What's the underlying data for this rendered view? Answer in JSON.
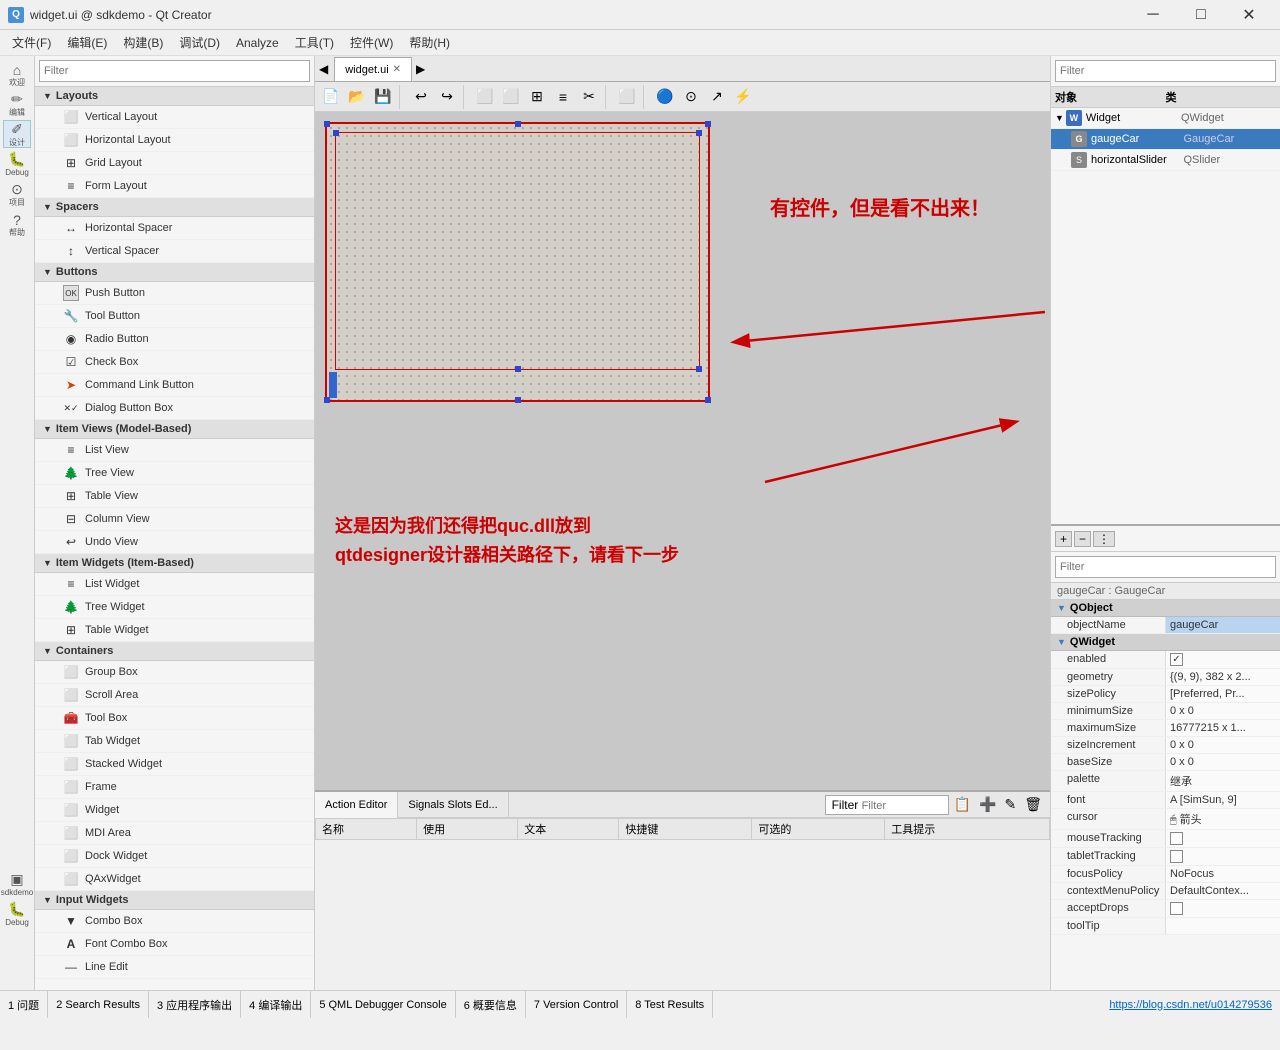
{
  "titleBar": {
    "appIcon": "Q",
    "title": "widget.ui @ sdkdemo - Qt Creator",
    "minimizeLabel": "─",
    "maximizeLabel": "□",
    "closeLabel": "✕"
  },
  "menuBar": {
    "items": [
      "文件(F)",
      "编辑(E)",
      "构建(B)",
      "调试(D)",
      "Analyze",
      "工具(T)",
      "控件(W)",
      "帮助(H)"
    ]
  },
  "tabs": [
    {
      "label": "widget.ui",
      "active": true
    }
  ],
  "widgetPanel": {
    "filterPlaceholder": "Filter",
    "categories": [
      {
        "name": "Layouts",
        "items": [
          {
            "label": "Vertical Layout",
            "icon": "⬜"
          },
          {
            "label": "Horizontal Layout",
            "icon": "⬜"
          },
          {
            "label": "Grid Layout",
            "icon": "⊞"
          },
          {
            "label": "Form Layout",
            "icon": "≡"
          }
        ]
      },
      {
        "name": "Spacers",
        "items": [
          {
            "label": "Horizontal Spacer",
            "icon": "↔"
          },
          {
            "label": "Vertical Spacer",
            "icon": "↕"
          }
        ]
      },
      {
        "name": "Buttons",
        "items": [
          {
            "label": "Push Button",
            "icon": "⬜"
          },
          {
            "label": "Tool Button",
            "icon": "🔧"
          },
          {
            "label": "Radio Button",
            "icon": "◉"
          },
          {
            "label": "Check Box",
            "icon": "☑"
          },
          {
            "label": "Command Link Button",
            "icon": "➤"
          },
          {
            "label": "Dialog Button Box",
            "icon": "⬜"
          }
        ]
      },
      {
        "name": "Item Views (Model-Based)",
        "items": [
          {
            "label": "List View",
            "icon": "≡"
          },
          {
            "label": "Tree View",
            "icon": "🌲"
          },
          {
            "label": "Table View",
            "icon": "⊞"
          },
          {
            "label": "Column View",
            "icon": "⊟"
          },
          {
            "label": "Undo View",
            "icon": "↩"
          }
        ]
      },
      {
        "name": "Item Widgets (Item-Based)",
        "items": [
          {
            "label": "List Widget",
            "icon": "≡"
          },
          {
            "label": "Tree Widget",
            "icon": "🌲"
          },
          {
            "label": "Table Widget",
            "icon": "⊞"
          }
        ]
      },
      {
        "name": "Containers",
        "items": [
          {
            "label": "Group Box",
            "icon": "⬜"
          },
          {
            "label": "Scroll Area",
            "icon": "⬜"
          },
          {
            "label": "Tool Box",
            "icon": "🧰"
          },
          {
            "label": "Tab Widget",
            "icon": "⬜"
          },
          {
            "label": "Stacked Widget",
            "icon": "⬜"
          },
          {
            "label": "Frame",
            "icon": "⬜"
          },
          {
            "label": "Widget",
            "icon": "⬜"
          },
          {
            "label": "MDI Area",
            "icon": "⬜"
          },
          {
            "label": "Dock Widget",
            "icon": "⬜"
          },
          {
            "label": "QAxWidget",
            "icon": "⬜"
          }
        ]
      },
      {
        "name": "Input Widgets",
        "items": [
          {
            "label": "Combo Box",
            "icon": "▼"
          },
          {
            "label": "Font Combo Box",
            "icon": "A"
          },
          {
            "label": "Line Edit",
            "icon": "—"
          }
        ]
      }
    ]
  },
  "objectInspector": {
    "filterPlaceholder": "Filter",
    "headers": {
      "col1": "对象",
      "col2": "类"
    },
    "objects": [
      {
        "level": 0,
        "name": "Widget",
        "class": "QWidget",
        "expanded": true,
        "icon": "W"
      },
      {
        "level": 1,
        "name": "gaugeCar",
        "class": "GaugeCar",
        "selected": true,
        "icon": "G"
      },
      {
        "level": 1,
        "name": "horizontalSlider",
        "class": "QSlider",
        "icon": "S"
      }
    ]
  },
  "propertyEditor": {
    "filterPlaceholder": "Filter",
    "subtitle": "gaugeCar : GaugeCar",
    "addBtn": "+",
    "removeBtn": "−",
    "moreBtn": "⋮",
    "groups": [
      {
        "name": "QObject",
        "expanded": true,
        "props": [
          {
            "name": "objectName",
            "value": "gaugeCar",
            "highlight": true
          }
        ]
      },
      {
        "name": "QWidget",
        "expanded": true,
        "props": [
          {
            "name": "enabled",
            "value": "checkbox_checked",
            "type": "checkbox"
          },
          {
            "name": "geometry",
            "value": "{(9, 9), 382 x 2..."
          },
          {
            "name": "sizePolicy",
            "value": "[Preferred, Pr..."
          },
          {
            "name": "minimumSize",
            "value": "0 x 0"
          },
          {
            "name": "maximumSize",
            "value": "16777215 x 1..."
          },
          {
            "name": "sizeIncrement",
            "value": "0 x 0"
          },
          {
            "name": "baseSize",
            "value": "0 x 0"
          },
          {
            "name": "palette",
            "value": "继承"
          },
          {
            "name": "font",
            "value": "A [SimSun, 9]"
          },
          {
            "name": "cursor",
            "value": "🖱 箭头"
          },
          {
            "name": "mouseTracking",
            "value": "checkbox_unchecked",
            "type": "checkbox"
          },
          {
            "name": "tabletTracking",
            "value": "checkbox_unchecked",
            "type": "checkbox"
          },
          {
            "name": "focusPolicy",
            "value": "NoFocus"
          },
          {
            "name": "contextMenuPolicy",
            "value": "DefaultContex..."
          },
          {
            "name": "acceptDrops",
            "value": "checkbox_unchecked",
            "type": "checkbox"
          },
          {
            "name": "toolTip",
            "value": ""
          }
        ]
      }
    ]
  },
  "actionEditor": {
    "tabLabels": [
      "Action Editor",
      "Signals Slots Ed..."
    ],
    "filterPlaceholder": "Filter",
    "tableHeaders": [
      "名称",
      "使用",
      "文本",
      "快捷键",
      "可选的",
      "工具提示"
    ],
    "toolbarButtons": [
      "📋",
      "➕",
      "✎",
      "🗑"
    ]
  },
  "annotations": {
    "text1": "有控件，但是看不出来！",
    "text2": "这是因为我们还得把quc.dll放到\nqtdesigner设计器相关路径下，请看下一步"
  },
  "statusBar": {
    "items": [
      "1 问题",
      "2 Search Results",
      "3 应用程序输出",
      "4 编译输出",
      "5 QML Debugger Console",
      "6 概要信息",
      "7 Version Control",
      "8 Test Results"
    ],
    "url": "https://blog.csdn.net/u014279536"
  },
  "leftIcons": [
    {
      "label": "欢迎",
      "icon": "⌂"
    },
    {
      "label": "编辑",
      "icon": "✏"
    },
    {
      "label": "设计",
      "icon": "✐",
      "active": true
    },
    {
      "label": "Debug",
      "icon": "🐞"
    },
    {
      "label": "项目",
      "icon": "⊙"
    },
    {
      "label": "帮助",
      "icon": "?"
    },
    {
      "label": "sdkdemo",
      "icon": "▣"
    },
    {
      "label": "Debug",
      "icon": "🐞"
    }
  ]
}
